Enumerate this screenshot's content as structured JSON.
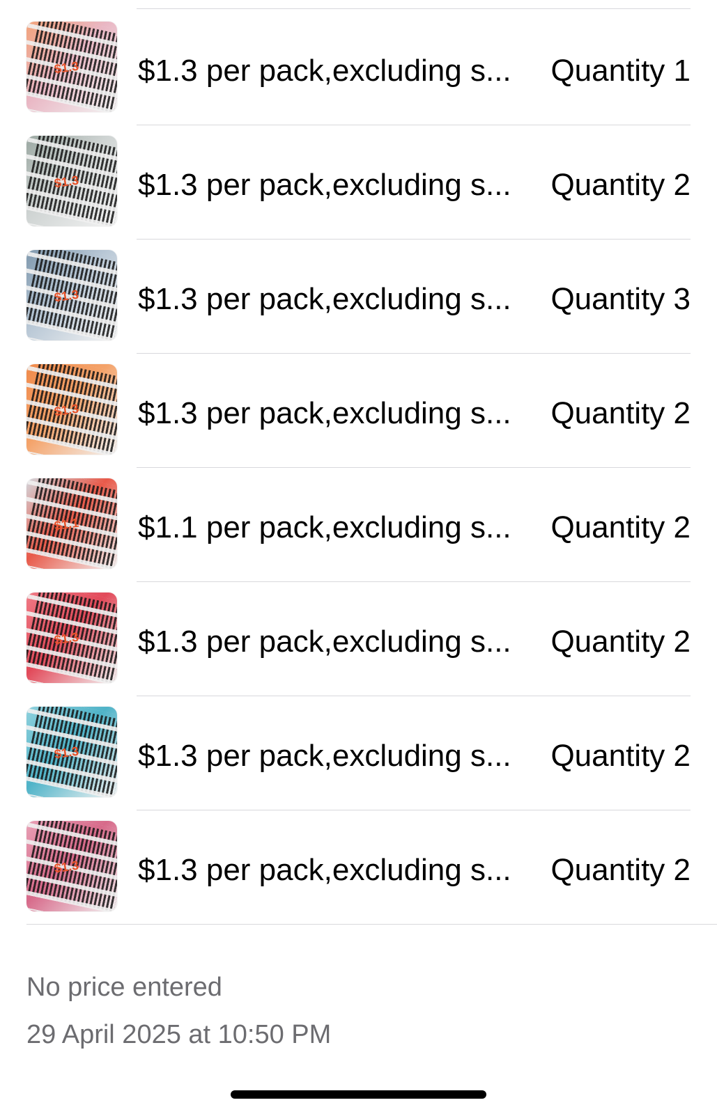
{
  "items": [
    {
      "title": "$1.3 per pack,excluding s...",
      "quantity": "Quantity 1",
      "thumb_price": "$1.3",
      "thumb_bg": "#e9b7c4",
      "thumb_accent": "#f2a27a",
      "icon": "eyelash-tray-photo"
    },
    {
      "title": "$1.3 per pack,excluding s...",
      "quantity": "Quantity 2",
      "thumb_price": "$1.3",
      "thumb_bg": "#cfd4d3",
      "thumb_accent": "#9aa7a1",
      "icon": "eyelash-tray-photo"
    },
    {
      "title": "$1.3 per pack,excluding s...",
      "quantity": "Quantity 3",
      "thumb_price": "$1.3",
      "thumb_bg": "#b9c8d6",
      "thumb_accent": "#7f98ad",
      "icon": "eyelash-tray-photo"
    },
    {
      "title": "$1.3 per pack,excluding s...",
      "quantity": "Quantity 2",
      "thumb_price": "$1.3",
      "thumb_bg": "#f4a36a",
      "thumb_accent": "#f08a4b",
      "icon": "eyelash-tray-photo"
    },
    {
      "title": "$1.1 per pack,excluding s...",
      "quantity": "Quantity 2",
      "thumb_price": "$1.1",
      "thumb_bg": "#e85a4a",
      "thumb_accent": "#d2d6dc",
      "icon": "eyelash-tray-photo"
    },
    {
      "title": "$1.3 per pack,excluding s...",
      "quantity": "Quantity 2",
      "thumb_price": "$1.3",
      "thumb_bg": "#e24a5a",
      "thumb_accent": "#f07a85",
      "icon": "eyelash-tray-photo"
    },
    {
      "title": "$1.3 per pack,excluding s...",
      "quantity": "Quantity 2",
      "thumb_price": "$1.3",
      "thumb_bg": "#4fb3c8",
      "thumb_accent": "#8fd1dd",
      "icon": "eyelash-tray-photo"
    },
    {
      "title": "$1.3 per pack,excluding s...",
      "quantity": "Quantity 2",
      "thumb_price": "$1.3",
      "thumb_bg": "#d76a8a",
      "thumb_accent": "#e8a0b5",
      "icon": "eyelash-tray-photo"
    }
  ],
  "footer": {
    "price_note": "No price entered",
    "timestamp": "29 April 2025 at 10:50 PM"
  },
  "colors": {
    "secondary_text": "#6c6c70",
    "divider": "#d8d8dc",
    "price_mark": "#e8532a"
  }
}
